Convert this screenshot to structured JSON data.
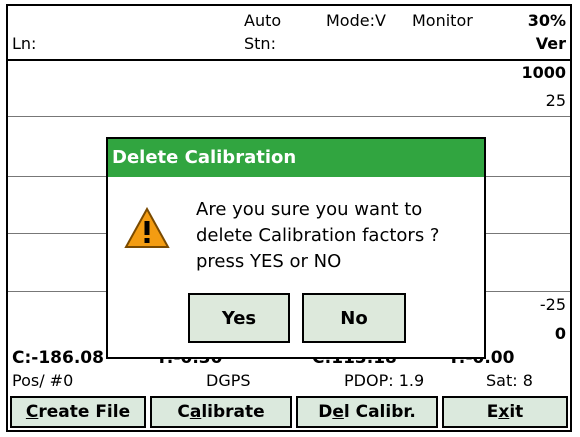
{
  "header": {
    "ln_label": "Ln:",
    "auto_label": "Auto",
    "stn_label": "Stn:",
    "mode_label": "Mode:V",
    "monitor_label": "Monitor",
    "percent": "30%",
    "ver_label": "Ver"
  },
  "graph": {
    "scale_top": "1000",
    "tick_top": "25",
    "tick_bottom": "-25",
    "scale_bottom": "0"
  },
  "dialog": {
    "title": "Delete Calibration",
    "message_line1": "Are you sure you want to",
    "message_line2": "delete Calibration factors ?",
    "message_line3": "press  YES  or  NO",
    "yes_label": "Yes",
    "no_label": "No",
    "icon": "warning-icon"
  },
  "status": {
    "c_value": "C:-186.08",
    "t_value1": "T:-0.30",
    "c_value2": "C:113.18",
    "t_value2": "T:-0.00",
    "pos": "Pos/ #0",
    "dgps": "DGPS",
    "pdop": "PDOP: 1.9",
    "sat": "Sat: 8"
  },
  "toolbar": {
    "create_file_c": "C",
    "create_file_rest": "reate File",
    "calibrate_pre": "C",
    "calibrate_ul": "a",
    "calibrate_rest": "librate",
    "del_pre": "D",
    "del_ul": "e",
    "del_rest": "l Calibr.",
    "exit_pre": "E",
    "exit_ul": "x",
    "exit_rest": "it"
  },
  "colors": {
    "title_bar": "#31a540",
    "button_bg": "#dbe9dd",
    "warning": "#f39c12"
  }
}
